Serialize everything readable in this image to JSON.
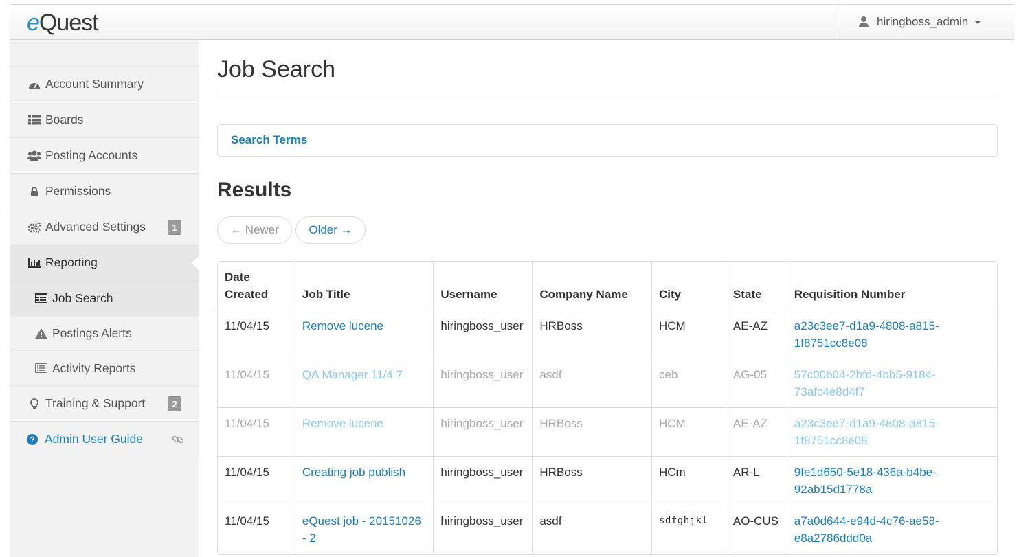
{
  "app": {
    "logo_e": "e",
    "logo_rest": "Quest",
    "user": "hiringboss_admin"
  },
  "sidebar": {
    "items": [
      {
        "label": "Account Summary",
        "icon": "dashboard-icon"
      },
      {
        "label": "Boards",
        "icon": "list-icon"
      },
      {
        "label": "Posting Accounts",
        "icon": "users-icon"
      },
      {
        "label": "Permissions",
        "icon": "lock-icon"
      },
      {
        "label": "Advanced Settings",
        "icon": "gears-icon",
        "badge": "1"
      },
      {
        "label": "Reporting",
        "icon": "bar-chart-icon"
      },
      {
        "label": "Job Search",
        "icon": "table-icon"
      },
      {
        "label": "Postings Alerts",
        "icon": "warning-icon"
      },
      {
        "label": "Activity Reports",
        "icon": "list-alt-icon"
      },
      {
        "label": "Training & Support",
        "icon": "lightbulb-icon",
        "badge": "2"
      },
      {
        "label": "Admin User Guide",
        "icon": "question-circle-icon"
      }
    ]
  },
  "main": {
    "title": "Job Search",
    "search_terms": "Search Terms",
    "results_heading": "Results",
    "pager": {
      "newer": "← Newer",
      "older": "Older →"
    },
    "columns": [
      "Date Created",
      "Job Title",
      "Username",
      "Company Name",
      "City",
      "State",
      "Requisition Number"
    ],
    "rows": [
      {
        "date": "11/04/15",
        "title": "Remove lucene",
        "username": "hiringboss_user",
        "company": "HRBoss",
        "city": "HCM",
        "state": "AE-AZ",
        "req": "a23c3ee7-d1a9-4808-a815-1f8751cc8e08",
        "dim": false
      },
      {
        "date": "11/04/15",
        "title": "QA Manager 11/4 7",
        "username": "hiringboss_user",
        "company": "asdf",
        "city": "ceb",
        "state": "AG-05",
        "req": "57c00b04-2bfd-4bb5-9184-73afc4e8d4f7",
        "dim": true
      },
      {
        "date": "11/04/15",
        "title": "Remove lucene",
        "username": "hiringboss_user",
        "company": "HRBoss",
        "city": "HCM",
        "state": "AE-AZ",
        "req": "a23c3ee7-d1a9-4808-a815-1f8751cc8e08",
        "dim": true
      },
      {
        "date": "11/04/15",
        "title": "Creating job publish",
        "username": "hiringboss_user",
        "company": "HRBoss",
        "city": "HCm",
        "state": "AR-L",
        "req": "9fe1d650-5e18-436a-b4be-92ab15d1778a",
        "dim": false
      },
      {
        "date": "11/04/15",
        "title": "eQuest job - 20151026 - 2",
        "username": "hiringboss_user",
        "company": "asdf",
        "city": "sdfghjkl",
        "state": "AO-CUS",
        "req": "a7a0d644-e94d-4c76-ae58-e8a2786ddd0a",
        "dim": false
      }
    ]
  }
}
